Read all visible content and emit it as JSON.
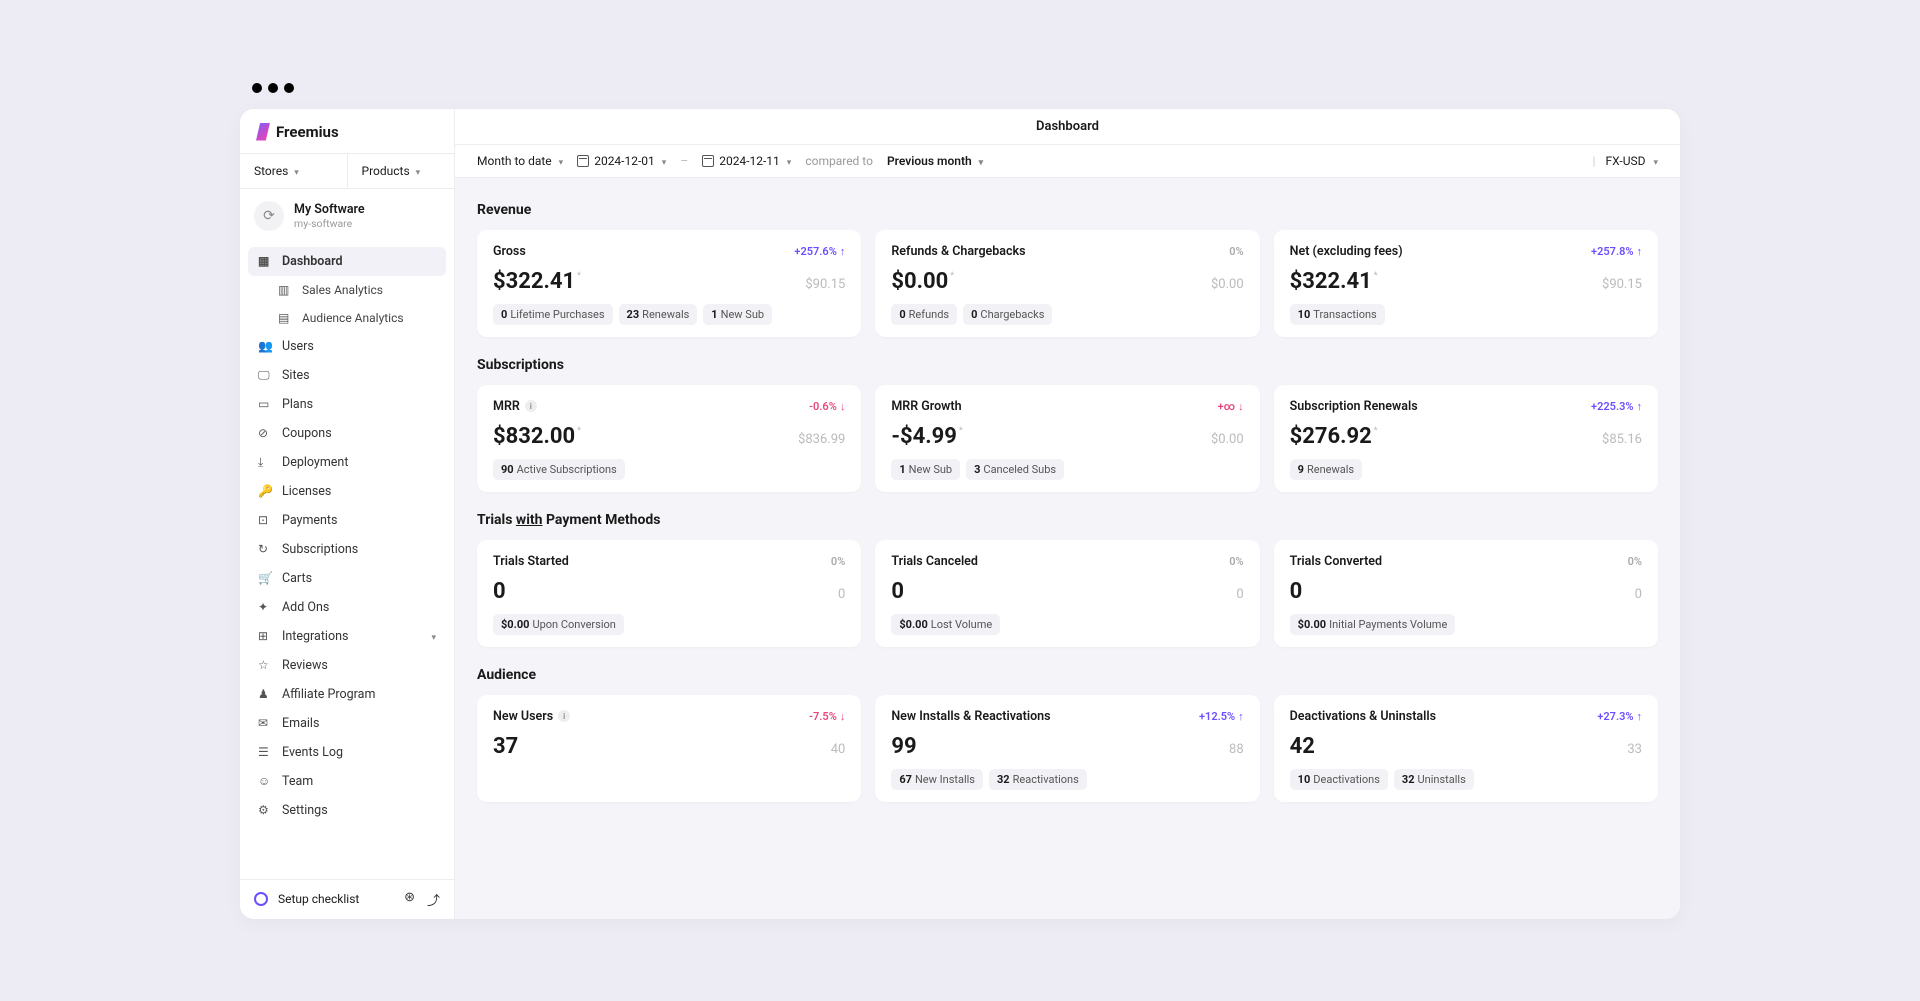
{
  "brand": "Freemius",
  "dropdowns": {
    "stores": "Stores",
    "products": "Products"
  },
  "product": {
    "name": "My Software",
    "slug": "my-software"
  },
  "nav": {
    "dashboard": "Dashboard",
    "sales_analytics": "Sales Analytics",
    "audience_analytics": "Audience Analytics",
    "users": "Users",
    "sites": "Sites",
    "plans": "Plans",
    "coupons": "Coupons",
    "deployment": "Deployment",
    "licenses": "Licenses",
    "payments": "Payments",
    "subscriptions": "Subscriptions",
    "carts": "Carts",
    "addons": "Add Ons",
    "integrations": "Integrations",
    "reviews": "Reviews",
    "affiliate": "Affiliate Program",
    "emails": "Emails",
    "events_log": "Events Log",
    "team": "Team",
    "settings": "Settings"
  },
  "footer": {
    "setup": "Setup checklist"
  },
  "tab": "Dashboard",
  "filter": {
    "range": "Month to date",
    "from": "2024-12-01",
    "to": "2024-12-11",
    "compared_label": "compared to",
    "compared_value": "Previous month",
    "currency": "FX-USD"
  },
  "sections": {
    "revenue": {
      "title": "Revenue",
      "gross": {
        "title": "Gross",
        "change": "+257.6%",
        "value": "$322.41",
        "compare": "$90.15",
        "pills": [
          {
            "n": "0",
            "t": "Lifetime Purchases"
          },
          {
            "n": "23",
            "t": "Renewals"
          },
          {
            "n": "1",
            "t": "New Sub"
          }
        ]
      },
      "refunds": {
        "title": "Refunds & Chargebacks",
        "change": "0%",
        "value": "$0.00",
        "compare": "$0.00",
        "pills": [
          {
            "n": "0",
            "t": "Refunds"
          },
          {
            "n": "0",
            "t": "Chargebacks"
          }
        ]
      },
      "net": {
        "title": "Net (excluding fees)",
        "change": "+257.8%",
        "value": "$322.41",
        "compare": "$90.15",
        "pills": [
          {
            "n": "10",
            "t": "Transactions"
          }
        ]
      }
    },
    "subs": {
      "title": "Subscriptions",
      "mrr": {
        "title": "MRR",
        "change": "-0.6%",
        "value": "$832.00",
        "compare": "$836.99",
        "pills": [
          {
            "n": "90",
            "t": "Active Subscriptions"
          }
        ]
      },
      "growth": {
        "title": "MRR Growth",
        "change": "+∞",
        "value": "-$4.99",
        "compare": "$0.00",
        "pills": [
          {
            "n": "1",
            "t": "New Sub"
          },
          {
            "n": "3",
            "t": "Canceled Subs"
          }
        ]
      },
      "renewals": {
        "title": "Subscription Renewals",
        "change": "+225.3%",
        "value": "$276.92",
        "compare": "$85.16",
        "pills": [
          {
            "n": "9",
            "t": "Renewals"
          }
        ]
      }
    },
    "trials": {
      "title_prefix": "Trials ",
      "title_underlined": "with",
      "title_suffix": " Payment Methods",
      "started": {
        "title": "Trials Started",
        "change": "0%",
        "value": "0",
        "compare": "0",
        "pills": [
          {
            "n": "$0.00",
            "t": "Upon Conversion"
          }
        ]
      },
      "canceled": {
        "title": "Trials Canceled",
        "change": "0%",
        "value": "0",
        "compare": "0",
        "pills": [
          {
            "n": "$0.00",
            "t": "Lost Volume"
          }
        ]
      },
      "converted": {
        "title": "Trials Converted",
        "change": "0%",
        "value": "0",
        "compare": "0",
        "pills": [
          {
            "n": "$0.00",
            "t": "Initial Payments Volume"
          }
        ]
      }
    },
    "audience": {
      "title": "Audience",
      "new_users": {
        "title": "New Users",
        "change": "-7.5%",
        "value": "37",
        "compare": "40",
        "pills": []
      },
      "installs": {
        "title": "New Installs & Reactivations",
        "change": "+12.5%",
        "value": "99",
        "compare": "88",
        "pills": [
          {
            "n": "67",
            "t": "New Installs"
          },
          {
            "n": "32",
            "t": "Reactivations"
          }
        ]
      },
      "deactivations": {
        "title": "Deactivations & Uninstalls",
        "change": "+27.3%",
        "value": "42",
        "compare": "33",
        "pills": [
          {
            "n": "10",
            "t": "Deactivations"
          },
          {
            "n": "32",
            "t": "Uninstalls"
          }
        ]
      }
    }
  }
}
